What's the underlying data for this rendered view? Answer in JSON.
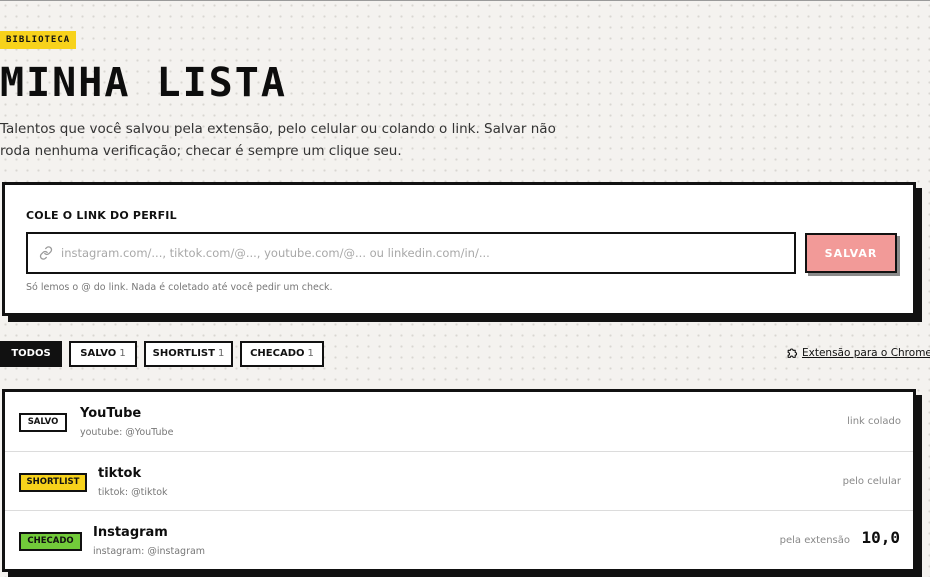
{
  "header": {
    "badge": "BIBLIOTECA",
    "title": "MINHA LISTA",
    "description": "Talentos que você salvou pela extensão, pelo celular ou colando o link. Salvar não roda nenhuma verificação; checar é sempre um clique seu."
  },
  "paste_card": {
    "label": "COLE O LINK DO PERFIL",
    "input_value": "",
    "input_placeholder": "instagram.com/..., tiktok.com/@..., youtube.com/@... ou linkedin.com/in/...",
    "save_button": "SALVAR",
    "hint": "Só lemos o @ do link. Nada é coletado até você pedir um check."
  },
  "filters": [
    {
      "label": "TODOS",
      "count": "",
      "active": true
    },
    {
      "label": "SALVO",
      "count": "1",
      "active": false
    },
    {
      "label": "SHORTLIST",
      "count": "1",
      "active": false
    },
    {
      "label": "CHECADO",
      "count": "1",
      "active": false
    }
  ],
  "extension_link": "Extensão para o Chrome",
  "items": [
    {
      "status": "SALVO",
      "name": "YouTube",
      "handle": "youtube: @YouTube",
      "source": "link colado",
      "score": ""
    },
    {
      "status": "SHORTLIST",
      "name": "tiktok",
      "handle": "tiktok: @tiktok",
      "source": "pelo celular",
      "score": ""
    },
    {
      "status": "CHECADO",
      "name": "Instagram",
      "handle": "instagram: @instagram",
      "source": "pela extensão",
      "score": "10,0"
    }
  ],
  "colors": {
    "badge_yellow": "#f7d21b",
    "save_button_pink": "#f29a98",
    "shortlist_yellow": "#f7d21b",
    "checado_green": "#72cb3a",
    "ink": "#111111"
  },
  "icons": [
    "link-icon",
    "puzzle-icon"
  ]
}
